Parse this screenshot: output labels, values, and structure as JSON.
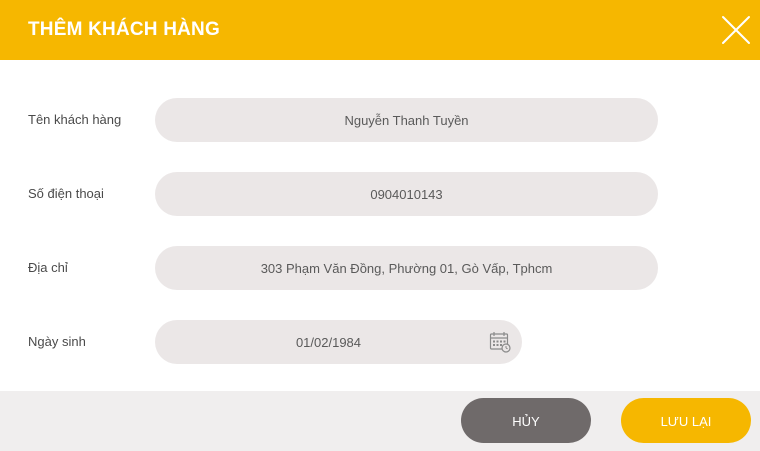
{
  "dialog": {
    "title": "THÊM KHÁCH HÀNG",
    "close_icon": "close-icon"
  },
  "form": {
    "name": {
      "label": "Tên khách hàng",
      "value": "Nguyễn Thanh Tuyền"
    },
    "phone": {
      "label": "Số điện thoại",
      "value": "0904010143"
    },
    "address": {
      "label": "Địa chỉ",
      "value": "303 Phạm Văn Đồng, Phường 01, Gò Vấp, Tphcm"
    },
    "birthday": {
      "label": "Ngày sinh",
      "value": "01/02/1984",
      "icon": "calendar-icon"
    }
  },
  "footer": {
    "cancel_label": "HỦY",
    "save_label": "LƯU LẠI"
  },
  "colors": {
    "accent": "#f6b700",
    "field_bg": "#ebe7e7",
    "cancel_bg": "#6f6a6a",
    "footer_bg": "#f0eeee"
  }
}
